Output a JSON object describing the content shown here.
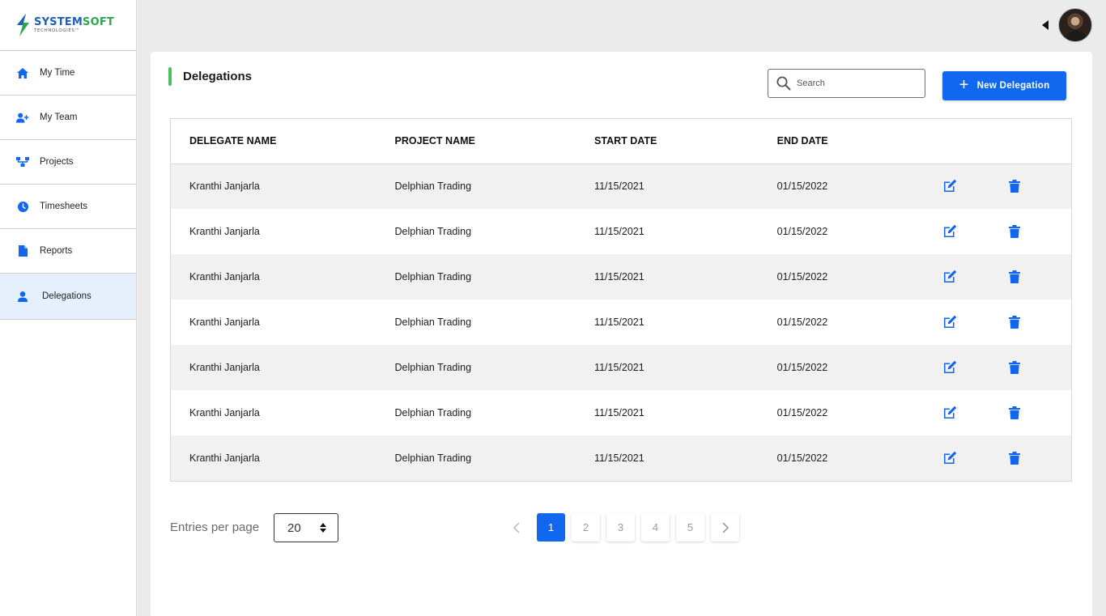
{
  "brand": {
    "name_part1": "SYSTEM",
    "name_part2": "SOFT",
    "tagline": "TECHNOLOGIES™"
  },
  "sidebar": {
    "items": [
      {
        "label": "My Time",
        "icon": "home-icon"
      },
      {
        "label": "My Team",
        "icon": "add-user-icon"
      },
      {
        "label": "Projects",
        "icon": "hierarchy-icon"
      },
      {
        "label": "Timesheets",
        "icon": "clock-icon"
      },
      {
        "label": "Reports",
        "icon": "document-icon"
      },
      {
        "label": "Delegations",
        "icon": "user-icon",
        "active": true
      }
    ]
  },
  "header": {
    "title": "Delegations"
  },
  "search": {
    "placeholder": "Search"
  },
  "actions": {
    "new_label": "New Delegation"
  },
  "table": {
    "columns": [
      "DELEGATE NAME",
      "PROJECT NAME",
      "START DATE",
      "END DATE"
    ],
    "rows": [
      [
        "Kranthi Janjarla",
        "Delphian Trading",
        "11/15/2021",
        "01/15/2022"
      ],
      [
        "Kranthi Janjarla",
        "Delphian Trading",
        "11/15/2021",
        "01/15/2022"
      ],
      [
        "Kranthi Janjarla",
        "Delphian Trading",
        "11/15/2021",
        "01/15/2022"
      ],
      [
        "Kranthi Janjarla",
        "Delphian Trading",
        "11/15/2021",
        "01/15/2022"
      ],
      [
        "Kranthi Janjarla",
        "Delphian Trading",
        "11/15/2021",
        "01/15/2022"
      ],
      [
        "Kranthi Janjarla",
        "Delphian Trading",
        "11/15/2021",
        "01/15/2022"
      ],
      [
        "Kranthi Janjarla",
        "Delphian Trading",
        "11/15/2021",
        "01/15/2022"
      ]
    ]
  },
  "footer": {
    "entries_label": "Entries per page",
    "entries_value": "20",
    "pages": [
      "1",
      "2",
      "3",
      "4",
      "5"
    ],
    "current_page": "1"
  },
  "colors": {
    "primary": "#1168ef",
    "accent_green": "#4cc15a",
    "active_nav_bg": "#e6f0fd"
  }
}
